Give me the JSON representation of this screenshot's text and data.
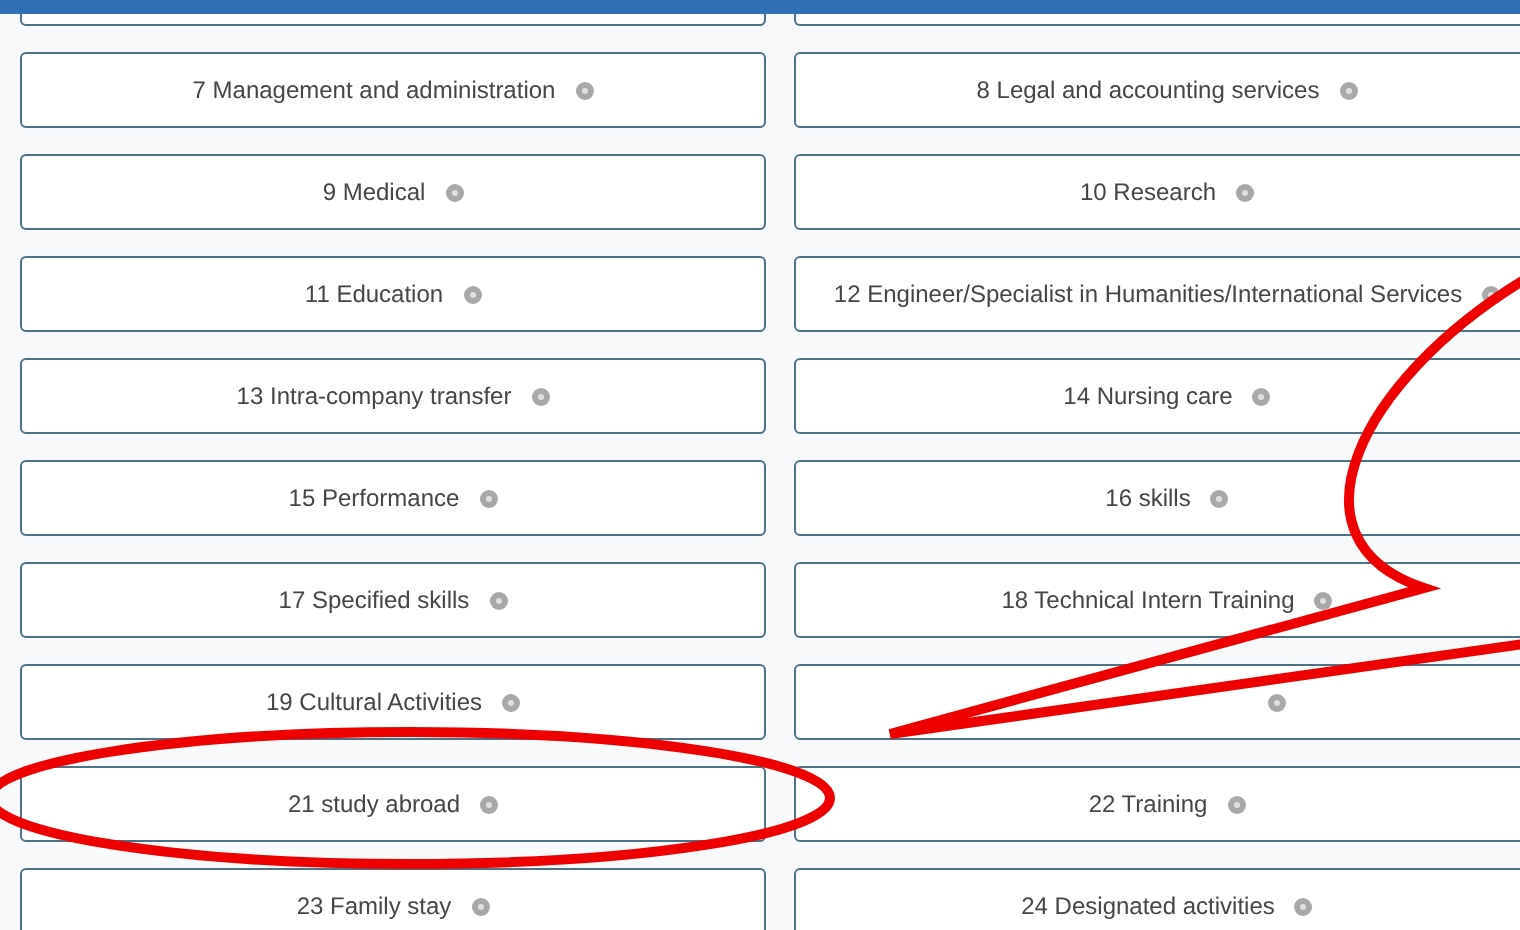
{
  "buttons": [
    {
      "kind": "text",
      "label": "7 Management and administration"
    },
    {
      "kind": "text",
      "label": "8 Legal and accounting services"
    },
    {
      "kind": "text",
      "label": "9 Medical"
    },
    {
      "kind": "text",
      "label": "10 Research"
    },
    {
      "kind": "text",
      "label": "11 Education"
    },
    {
      "kind": "text",
      "label": "12 Engineer/Specialist in Humanities/International Services"
    },
    {
      "kind": "text",
      "label": "13 Intra-company transfer"
    },
    {
      "kind": "text",
      "label": "14 Nursing care"
    },
    {
      "kind": "text",
      "label": "15 Performance"
    },
    {
      "kind": "text",
      "label": "16 skills"
    },
    {
      "kind": "text",
      "label": "17 Specified skills"
    },
    {
      "kind": "text",
      "label": "18 Technical Intern Training"
    },
    {
      "kind": "text",
      "label": "19 Cultural Activities"
    },
    {
      "kind": "covered"
    },
    {
      "kind": "text",
      "label": "21 study abroad"
    },
    {
      "kind": "text",
      "label": "22 Training"
    },
    {
      "kind": "text",
      "label": "23 Family stay"
    },
    {
      "kind": "text",
      "label": "24 Designated activities"
    }
  ]
}
